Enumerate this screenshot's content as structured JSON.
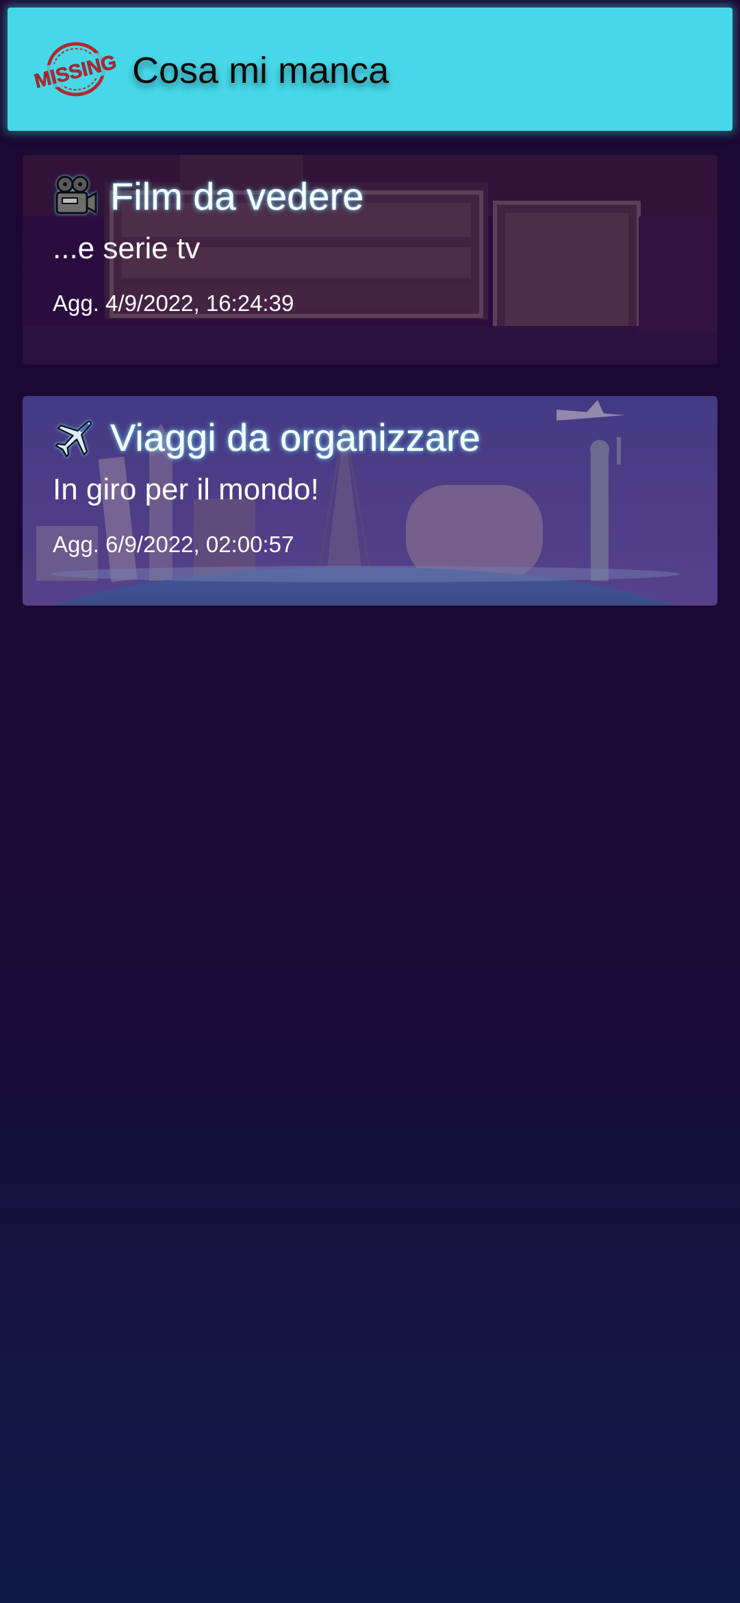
{
  "header": {
    "title": "Cosa mi manca",
    "logo_text": "MISSING",
    "logo_icon": "missing-stamp-logo",
    "background": "#46d8e9"
  },
  "lists": [
    {
      "icon": "movie-camera-icon",
      "title": "Film da vedere",
      "subtitle": "...e serie tv",
      "updated": "Agg. 4/9/2022, 16:24:39"
    },
    {
      "icon": "airplane-icon",
      "title": "Viaggi da organizzare",
      "subtitle": "In giro per il mondo!",
      "updated": "Agg. 6/9/2022, 02:00:57"
    }
  ]
}
